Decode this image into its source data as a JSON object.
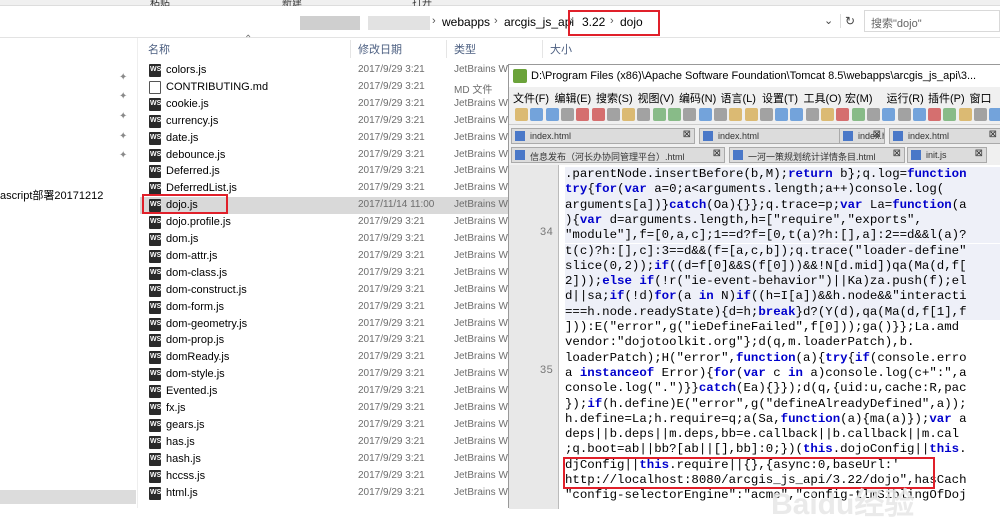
{
  "topbar": {
    "items": [
      "粘贴",
      "新建",
      "打开"
    ]
  },
  "address": {
    "crumbs": [
      "webapps",
      "arcgis_js_api",
      "3.22",
      "dojo"
    ],
    "dropdown_icon": "chevron-down-icon",
    "refresh_icon": "refresh-icon",
    "search_placeholder": "搜索\"dojo\""
  },
  "nav": {
    "label": "ascript部署20171212"
  },
  "columns": {
    "name": "名称",
    "date": "修改日期",
    "type": "类型",
    "size": "大小"
  },
  "files": [
    {
      "name": "colors.js",
      "date": "2017/9/29 3:21",
      "type": "JetBrains W",
      "icon": "js"
    },
    {
      "name": "CONTRIBUTING.md",
      "date": "2017/9/29 3:21",
      "type": "MD 文件",
      "icon": "doc"
    },
    {
      "name": "cookie.js",
      "date": "2017/9/29 3:21",
      "type": "JetBrains W",
      "icon": "js"
    },
    {
      "name": "currency.js",
      "date": "2017/9/29 3:21",
      "type": "JetBrains W",
      "icon": "js"
    },
    {
      "name": "date.js",
      "date": "2017/9/29 3:21",
      "type": "JetBrains W",
      "icon": "js"
    },
    {
      "name": "debounce.js",
      "date": "2017/9/29 3:21",
      "type": "JetBrains W",
      "icon": "js"
    },
    {
      "name": "Deferred.js",
      "date": "2017/9/29 3:21",
      "type": "JetBrains W",
      "icon": "js"
    },
    {
      "name": "DeferredList.js",
      "date": "2017/9/29 3:21",
      "type": "JetBrains W",
      "icon": "js"
    },
    {
      "name": "dojo.js",
      "date": "2017/11/14 11:00",
      "type": "JetBrains W",
      "icon": "js"
    },
    {
      "name": "dojo.profile.js",
      "date": "2017/9/29 3:21",
      "type": "JetBrains W",
      "icon": "js"
    },
    {
      "name": "dom.js",
      "date": "2017/9/29 3:21",
      "type": "JetBrains W",
      "icon": "js"
    },
    {
      "name": "dom-attr.js",
      "date": "2017/9/29 3:21",
      "type": "JetBrains W",
      "icon": "js"
    },
    {
      "name": "dom-class.js",
      "date": "2017/9/29 3:21",
      "type": "JetBrains W",
      "icon": "js"
    },
    {
      "name": "dom-construct.js",
      "date": "2017/9/29 3:21",
      "type": "JetBrains W",
      "icon": "js"
    },
    {
      "name": "dom-form.js",
      "date": "2017/9/29 3:21",
      "type": "JetBrains W",
      "icon": "js"
    },
    {
      "name": "dom-geometry.js",
      "date": "2017/9/29 3:21",
      "type": "JetBrains W",
      "icon": "js"
    },
    {
      "name": "dom-prop.js",
      "date": "2017/9/29 3:21",
      "type": "JetBrains W",
      "icon": "js"
    },
    {
      "name": "domReady.js",
      "date": "2017/9/29 3:21",
      "type": "JetBrains W",
      "icon": "js"
    },
    {
      "name": "dom-style.js",
      "date": "2017/9/29 3:21",
      "type": "JetBrains W",
      "icon": "js"
    },
    {
      "name": "Evented.js",
      "date": "2017/9/29 3:21",
      "type": "JetBrains W",
      "icon": "js"
    },
    {
      "name": "fx.js",
      "date": "2017/9/29 3:21",
      "type": "JetBrains W",
      "icon": "js"
    },
    {
      "name": "gears.js",
      "date": "2017/9/29 3:21",
      "type": "JetBrains W",
      "icon": "js"
    },
    {
      "name": "has.js",
      "date": "2017/9/29 3:21",
      "type": "JetBrains W",
      "icon": "js"
    },
    {
      "name": "hash.js",
      "date": "2017/9/29 3:21",
      "type": "JetBrains W",
      "icon": "js"
    },
    {
      "name": "hccss.js",
      "date": "2017/9/29 3:21",
      "type": "JetBrains W",
      "icon": "js"
    },
    {
      "name": "html.js",
      "date": "2017/9/29 3:21",
      "type": "JetBrains W",
      "icon": "js"
    }
  ],
  "notepad": {
    "title": "D:\\Program Files (x86)\\Apache Software Foundation\\Tomcat 8.5\\webapps\\arcgis_js_api\\3...",
    "menu": [
      "文件(F)",
      "编辑(E)",
      "搜索(S)",
      "视图(V)",
      "编码(N)",
      "语言(L)",
      "设置(T)",
      "工具(O)",
      "宏(M)",
      "运行(R)",
      "插件(P)",
      "窗口"
    ],
    "tabs_row1": [
      "index.html",
      "index.html",
      "index.html",
      "index.html"
    ],
    "tabs_row2": [
      "信息发布（河长办协同管理平台）.html",
      "一河一策规划统计详情条目.html",
      "init.js"
    ],
    "line_numbers": [
      "34",
      "35"
    ],
    "code_lines": [
      ".parentNode.insertBefore(b,M);return b};q.log=function",
      "try{for(var a=0;a<arguments.length;a++)console.log(",
      "arguments[a])}catch(Oa){}};q.trace=p;var La=function(a",
      "){var d=arguments.length,h=[\"require\",\"exports\",",
      "\"module\"],f=[0,a,c];1==d?f=[0,t(a)?h:[],a]:2==d&&l(a)?",
      "t(c)?h:[],c]:3==d&&(f=[a,c,b]);q.trace(\"loader-define\"",
      "slice(0,2));if((d=f[0]&&S(f[0]))&&!N[d.mid])qa(Ma(d,f[",
      "2]));else if(!r(\"ie-event-behavior\")||Ka)za.push(f);el",
      "d||sa;if(!d)for(a in N)if((h=I[a])&&h.node&&\"interacti",
      "===h.node.readyState){d=h;break}d?(Y(d),qa(Ma(d,f[1],f",
      "])):E(\"error\",g(\"ieDefineFailed\",f[0]));ga()}};La.amd",
      "vendor:\"dojotoolkit.org\"};d(q,m.loaderPatch),b.",
      "loaderPatch);H(\"error\",function(a){try{if(console.erro",
      "a instanceof Error){for(var c in a)console.log(c+\":\",a",
      "console.log(\".\")}}catch(Ea){}});d(q,{uid:u,cache:R,pac",
      "});if(h.define)E(\"error\",g(\"defineAlreadyDefined\",a));",
      "h.define=La;h.require=q;a(Sa,function(a){ma(a)});var a",
      "deps||b.deps||m.deps,bb=e.callback||b.callback||m.cal",
      ";q.boot=ab||bb?[ab||[],bb]:0;})(this.dojoConfig||this.",
      "djConfig||this.require||{},{async:0,baseUrl:'",
      "http://localhost:8080/arcgis_js_api/3.22/dojo\",hasCach",
      "\"config-selectorEngine\":\"acme\",\"config-tlmSiblingOfDoj"
    ],
    "watermark": "Baidu经验"
  },
  "colors": {
    "highlight_red": "#e0202a",
    "keyword": "#0000cc"
  }
}
